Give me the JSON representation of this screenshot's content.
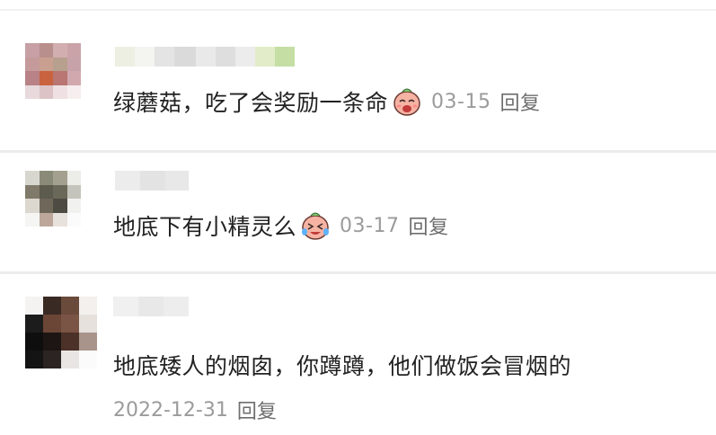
{
  "comments": [
    {
      "text": "绿蘑菇，吃了会奖励一条命",
      "sticker": "laughing-face-sticker-icon",
      "date": "03-15",
      "reply_label": "回复"
    },
    {
      "text": "地底下有小精灵么",
      "sticker": "crying-laughing-face-sticker-icon",
      "date": "03-17",
      "reply_label": "回复"
    },
    {
      "text": "地底矮人的烟囱，你蹲蹲，他们做饭会冒烟的",
      "date": "2022-12-31",
      "reply_label": "回复"
    }
  ],
  "colors": {
    "text": "#222222",
    "meta": "#9b9b9b",
    "divider": "#ececec",
    "sticker_face": "#f7b9a8"
  }
}
